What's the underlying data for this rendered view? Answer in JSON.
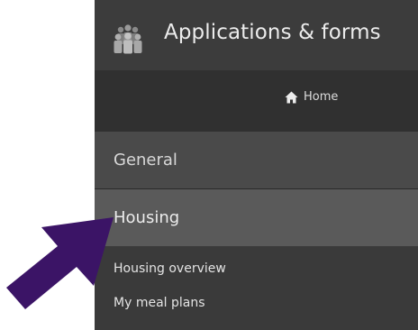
{
  "header": {
    "title": "Applications & forms",
    "icon": "people-group-icon"
  },
  "home_bar": {
    "home_label": "Home",
    "icon": "home-icon"
  },
  "nav": {
    "items": [
      {
        "label": "General",
        "state": "collapsed"
      },
      {
        "label": "Housing",
        "state": "expanded"
      }
    ],
    "housing_submenu": [
      {
        "label": "Housing overview"
      },
      {
        "label": "My meal plans"
      }
    ]
  },
  "annotation": {
    "arrow_color": "#3b1466",
    "points_to": "Housing"
  },
  "colors": {
    "panel_bg": "#3a3a3a",
    "home_bar_bg": "#303030",
    "general_bg": "#4a4a4a",
    "housing_bg": "#5a5a5a",
    "text": "#e4e4e4"
  }
}
